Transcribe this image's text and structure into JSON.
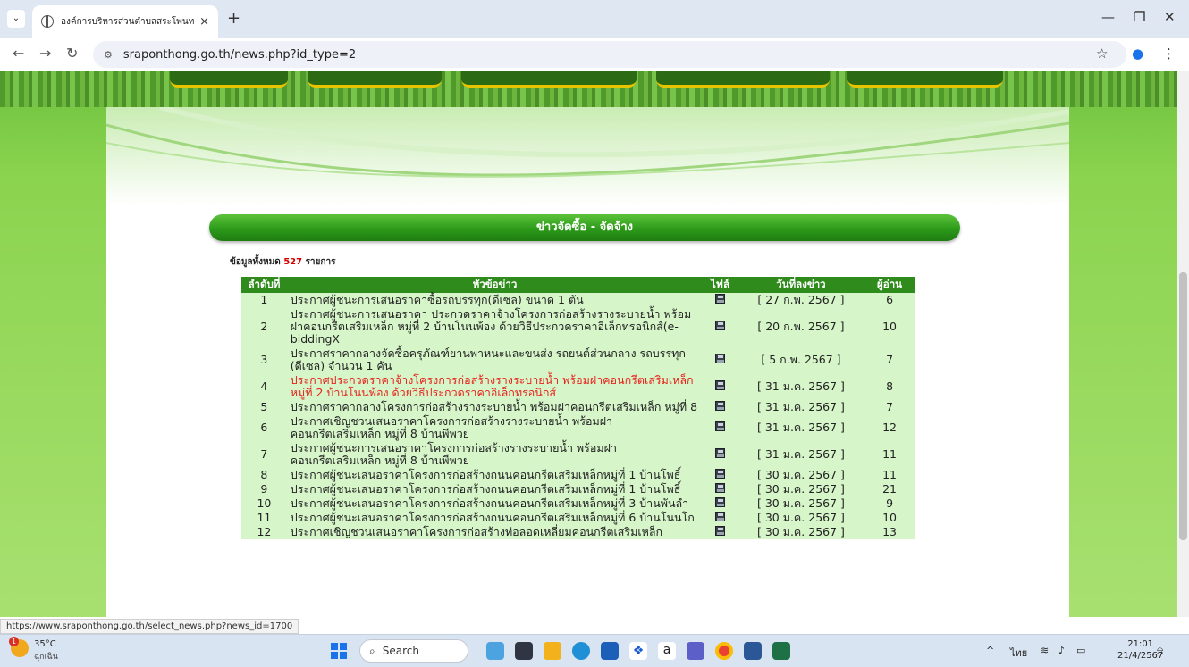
{
  "browser": {
    "tab_title": "องค์การบริหารส่วนตำบลสระโพนทอง",
    "tab_close": "×",
    "new_tab": "+",
    "tab_menu": "⌄",
    "url": "sraponthong.go.th/news.php?id_type=2",
    "status_url": "https://www.sraponthong.go.th/select_news.php?news_id=1700"
  },
  "page": {
    "header": "ข่าวจัดซื้อ - จัดจ้าง",
    "count_prefix": "ข้อมูลทั้งหมด",
    "count_value": "527",
    "count_suffix": "รายการ",
    "columns": {
      "no": "ลำดับที่",
      "title": "หัวข้อข่าว",
      "file": "ไฟล์",
      "date": "วันที่ลงข่าว",
      "reads": "ผู้อ่าน"
    },
    "rows": [
      {
        "no": "1",
        "title": "ประกาศผู้ชนะการเสนอราคาซื้อรถบรรทุก(ดีเซล) ขนาด 1 ตัน",
        "date": "[ 27 ก.พ. 2567 ]",
        "reads": "6",
        "red": false
      },
      {
        "no": "2",
        "title": "ประกาศผู้ชนะการเสนอราคา ประกวดราคาจ้างโครงการก่อสร้างรางระบายน้ำ พร้อมฝาคอนกรีตเสริมเหล็ก หมู่ที่ 2 บ้านโนนพ้อง ด้วยวิธีประกวดราคาอิเล็กทรอนิกส์(e-biddingX",
        "date": "[ 20 ก.พ. 2567 ]",
        "reads": "10",
        "red": false
      },
      {
        "no": "3",
        "title": "ประกาศราคากลางจัดซื้อครุภัณฑ์ยานพาหนะและขนส่ง รถยนต์ส่วนกลาง รถบรรทุก (ดีเซล) จำนวน 1 คัน",
        "date": "[ 5 ก.พ. 2567 ]",
        "reads": "7",
        "red": false
      },
      {
        "no": "4",
        "title": "ประกาศประกวดราคาจ้างโครงการก่อสร้างรางระบายน้ำ พร้อมฝาคอนกรีตเสริมเหล็ก หมู่ที่ 2 บ้านโนนพ้อง ด้วยวิธีประกวดราคาอิเล็กทรอนิกส์",
        "date": "[ 31 ม.ค. 2567 ]",
        "reads": "8",
        "red": true
      },
      {
        "no": "5",
        "title": "ประกาศราคากลางโครงการก่อสร้างรางระบายน้ำ พร้อมฝาคอนกรีตเสริมเหล็ก หมู่ที่ 8",
        "date": "[ 31 ม.ค. 2567 ]",
        "reads": "7",
        "red": false
      },
      {
        "no": "6",
        "title": "ประกาศเชิญชวนเสนอราคาโครงการก่อสร้างรางระบายน้ำ พร้อมฝาคอนกรีตเสริมเหล็ก หมู่ที่ 8 บ้านพีพวย",
        "date": "[ 31 ม.ค. 2567 ]",
        "reads": "12",
        "red": false
      },
      {
        "no": "7",
        "title": "ประกาศผู้ชนะการเสนอราคาโครงการก่อสร้างรางระบายน้ำ พร้อมฝาคอนกรีตเสริมเหล็ก หมู่ที่ 8 บ้านพีพวย",
        "date": "[ 31 ม.ค. 2567 ]",
        "reads": "11",
        "red": false
      },
      {
        "no": "8",
        "title": "ประกาศผู้ชนะเสนอราคาโครงการก่อสร้างถนนคอนกรีตเสริมเหล็กหมู่ที่ 1 บ้านโพธิ์",
        "date": "[ 30 ม.ค. 2567 ]",
        "reads": "11",
        "red": false
      },
      {
        "no": "9",
        "title": "ประกาศผู้ชนะเสนอราคาโครงการก่อสร้างถนนคอนกรีตเสริมเหล็กหมู่ที่ 1 บ้านโพธิ์",
        "date": "[ 30 ม.ค. 2567 ]",
        "reads": "21",
        "red": false
      },
      {
        "no": "10",
        "title": "ประกาศผู้ชนะเสนอราคาโครงการก่อสร้างถนนคอนกรีตเสริมเหล็กหมู่ที่ 3 บ้านพันลำ",
        "date": "[ 30 ม.ค. 2567 ]",
        "reads": "9",
        "red": false
      },
      {
        "no": "11",
        "title": "ประกาศผู้ชนะเสนอราคาโครงการก่อสร้างถนนคอนกรีตเสริมเหล็กหมู่ที่ 6 บ้านโนนโก",
        "date": "[ 30 ม.ค. 2567 ]",
        "reads": "10",
        "red": false
      },
      {
        "no": "12",
        "title": "ประกาศเชิญชวนเสนอราคาโครงการก่อสร้างท่อลอดเหลี่ยมคอนกรีตเสริมเหล็ก",
        "date": "[ 30 ม.ค. 2567 ]",
        "reads": "13",
        "red": false
      }
    ]
  },
  "taskbar": {
    "temp": "35°C",
    "condition": "ฉุกเฉิน",
    "weather_badge": "1",
    "search_label": "Search",
    "lang": "ไทย",
    "time": "21:01",
    "date": "21/4/2567"
  },
  "colors": {
    "accent": "#2e8b1c",
    "row_bg": "#d6f5c9",
    "red_text": "#e8221c"
  }
}
